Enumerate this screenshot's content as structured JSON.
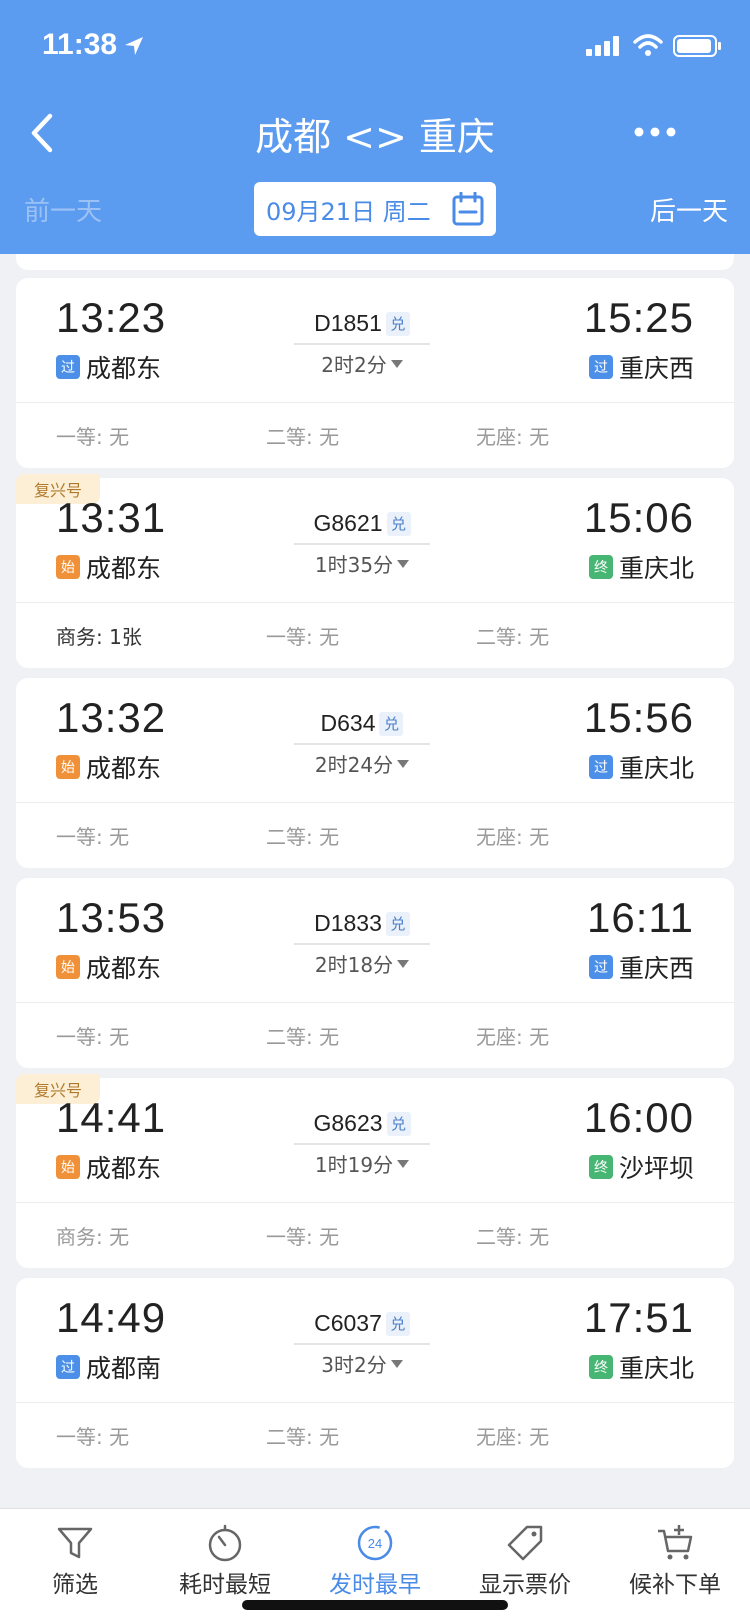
{
  "status": {
    "time": "11:38"
  },
  "header": {
    "route_title": "成都 <> 重庆",
    "prev_day": "前一天",
    "next_day": "后一天",
    "date": "09月21日  周二"
  },
  "trains": [
    {
      "badge": "",
      "dep_time": "13:23",
      "dep_tag": "过",
      "dep_station": "成都东",
      "train_no": "D1851",
      "dui": "兑",
      "duration": "2时2分",
      "arr_time": "15:25",
      "arr_tag": "过",
      "arr_station": "重庆西",
      "seats": [
        "一等: 无",
        "二等: 无",
        "无座: 无"
      ]
    },
    {
      "badge": "复兴号",
      "dep_time": "13:31",
      "dep_tag": "始",
      "dep_station": "成都东",
      "train_no": "G8621",
      "dui": "兑",
      "duration": "1时35分",
      "arr_time": "15:06",
      "arr_tag": "终",
      "arr_station": "重庆北",
      "seats": [
        "商务: 1张",
        "一等: 无",
        "二等: 无"
      ]
    },
    {
      "badge": "",
      "dep_time": "13:32",
      "dep_tag": "始",
      "dep_station": "成都东",
      "train_no": "D634",
      "dui": "兑",
      "duration": "2时24分",
      "arr_time": "15:56",
      "arr_tag": "过",
      "arr_station": "重庆北",
      "seats": [
        "一等: 无",
        "二等: 无",
        "无座: 无"
      ]
    },
    {
      "badge": "",
      "dep_time": "13:53",
      "dep_tag": "始",
      "dep_station": "成都东",
      "train_no": "D1833",
      "dui": "兑",
      "duration": "2时18分",
      "arr_time": "16:11",
      "arr_tag": "过",
      "arr_station": "重庆西",
      "seats": [
        "一等: 无",
        "二等: 无",
        "无座: 无"
      ]
    },
    {
      "badge": "复兴号",
      "dep_time": "14:41",
      "dep_tag": "始",
      "dep_station": "成都东",
      "train_no": "G8623",
      "dui": "兑",
      "duration": "1时19分",
      "arr_time": "16:00",
      "arr_tag": "终",
      "arr_station": "沙坪坝",
      "seats": [
        "商务: 无",
        "一等: 无",
        "二等: 无"
      ]
    },
    {
      "badge": "",
      "dep_time": "14:49",
      "dep_tag": "过",
      "dep_station": "成都南",
      "train_no": "C6037",
      "dui": "兑",
      "duration": "3时2分",
      "arr_time": "17:51",
      "arr_tag": "终",
      "arr_station": "重庆北",
      "seats": [
        "一等: 无",
        "二等: 无",
        "无座: 无"
      ]
    }
  ],
  "tabs": [
    {
      "label": "筛选",
      "icon": "filter-icon"
    },
    {
      "label": "耗时最短",
      "icon": "stopwatch-icon"
    },
    {
      "label": "发时最早",
      "icon": "clock-24-icon",
      "active": true,
      "icon_text": "24"
    },
    {
      "label": "显示票价",
      "icon": "price-tag-icon"
    },
    {
      "label": "候补下单",
      "icon": "cart-add-icon"
    }
  ],
  "colors": {
    "header_bg": "#5b9bf0",
    "accent": "#4a8be8",
    "tag_pass": "#4b8fe8",
    "tag_start": "#f0913a",
    "tag_end": "#47b673"
  }
}
